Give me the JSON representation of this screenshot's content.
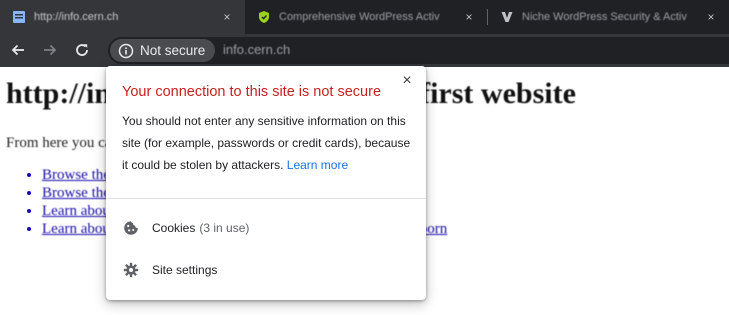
{
  "tabs": [
    {
      "title": "http://info.cern.ch",
      "close_icon": "×",
      "active": true
    },
    {
      "title": "Comprehensive WordPress Activ",
      "close_icon": "×",
      "active": false
    },
    {
      "title": "Niche WordPress Security & Activ",
      "close_icon": "×",
      "active": false
    }
  ],
  "omnibox": {
    "security_label": "Not secure",
    "url": "info.cern.ch"
  },
  "page": {
    "heading": "http://info.cern.ch - home of the first website",
    "intro": "From here you can:",
    "links": [
      "Browse the first website",
      "Browse the first website using the line-mode browser simulator",
      "Learn about the birth of the web",
      "Learn about CERN, the physics laboratory where the web was born"
    ]
  },
  "popup": {
    "close_icon": "×",
    "heading": "Your connection to this site is not secure",
    "body": "You should not enter any sensitive information on this site (for example, passwords or credit cards), because it could be stolen by attackers.",
    "learn_more": "Learn more",
    "cookies_label": "Cookies",
    "cookies_count": "(3 in use)",
    "site_settings_label": "Site settings"
  },
  "colors": {
    "warning_red": "#c5221f",
    "link_blue": "#1a73e8",
    "chrome_dark": "#35363a"
  }
}
